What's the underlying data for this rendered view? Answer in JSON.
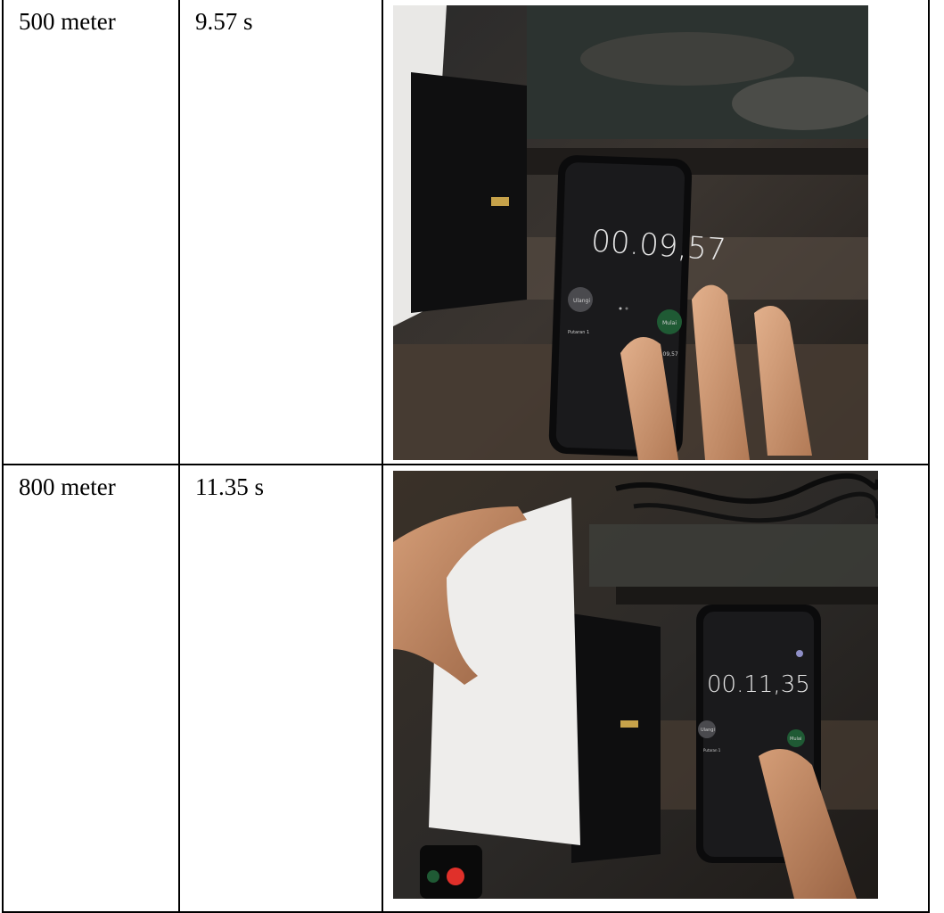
{
  "table": {
    "rows": [
      {
        "distance": "500 meter",
        "time": "9.57 s",
        "photo": {
          "stopwatch_reading": "00.09,57",
          "lap_reading": "00.09,57",
          "left_button": "Ulangi",
          "right_button": "Mulai",
          "lap_label": "Putaran 1"
        }
      },
      {
        "distance": "800 meter",
        "time": "11.35 s",
        "photo": {
          "stopwatch_reading": "00.11,35",
          "left_button": "Ulangi",
          "right_button": "Mulai",
          "lap_label": "Putaran 1"
        }
      }
    ]
  },
  "colors": {
    "border": "#000000",
    "screen": "#1a1a1c",
    "green_button": "#1f5a34",
    "red_button": "#e0302a"
  }
}
